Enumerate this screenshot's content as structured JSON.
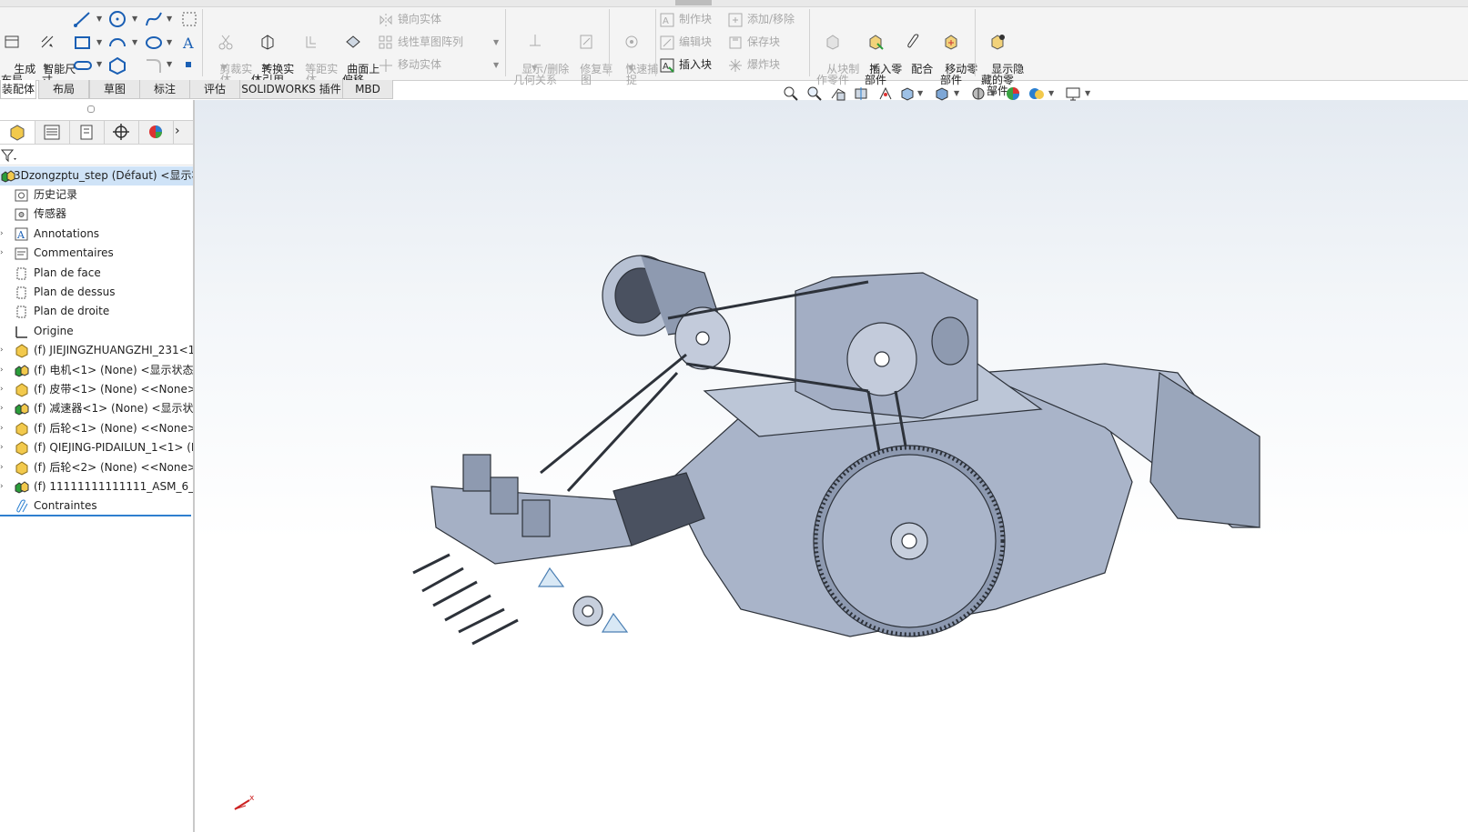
{
  "ribbon": {
    "row_group1": {
      "generate_layout": "生成\n布局",
      "smart_dimension": "智能尺\n寸"
    },
    "trim_entities": "剪裁实\n体",
    "convert_entities": "转换实\n体引用",
    "offset_entities": "等距实\n体",
    "offset_on_surface": "曲面上\n偏移",
    "mirror_entities": "镜向实体",
    "linear_pattern": "线性草图阵列",
    "move_entities": "移动实体",
    "display_delete_relations": "显示/删除\n几何关系",
    "repair_sketch": "修复草\n图",
    "quick_snaps": "快速捕\n捉",
    "make_block": "制作块",
    "edit_block": "编辑块",
    "insert_block": "插入块",
    "add_remove": "添加/移除",
    "save_block": "保存块",
    "explode_block": "爆炸块",
    "make_part_from_block": "从块制\n作零件",
    "insert_components": "插入零\n部件",
    "mate": "配合",
    "move_component": "移动零\n部件",
    "show_hidden_components": "显示隐\n藏的零\n部件"
  },
  "tabs": [
    {
      "label": "装配体",
      "active": true
    },
    {
      "label": "布局",
      "active": false
    },
    {
      "label": "草图",
      "active": false
    },
    {
      "label": "标注",
      "active": false
    },
    {
      "label": "评估",
      "active": false
    },
    {
      "label": "SOLIDWORKS 插件",
      "active": false
    },
    {
      "label": "MBD",
      "active": false
    }
  ],
  "tree": {
    "root": "3Dzongzptu_step (Défaut) <显示状",
    "items": [
      {
        "label": "历史记录",
        "icon": "history-icon"
      },
      {
        "label": "传感器",
        "icon": "sensor-icon"
      },
      {
        "label": "Annotations",
        "icon": "annotations-icon"
      },
      {
        "label": "Commentaires",
        "icon": "comments-icon"
      },
      {
        "label": "Plan de face",
        "icon": "plane-icon"
      },
      {
        "label": "Plan de dessus",
        "icon": "plane-icon"
      },
      {
        "label": "Plan de droite",
        "icon": "plane-icon"
      },
      {
        "label": "Origine",
        "icon": "origin-icon"
      },
      {
        "label": "(f) JIEJINGZHUANGZHI_231<1:",
        "icon": "part-icon"
      },
      {
        "label": "(f) 电机<1> (None) <显示状态-",
        "icon": "assembly-icon"
      },
      {
        "label": "(f) 皮带<1> (None) <<None>_",
        "icon": "part-icon"
      },
      {
        "label": "(f) 减速器<1> (None) <显示状态",
        "icon": "assembly-icon"
      },
      {
        "label": "(f) 后轮<1> (None) <<None>_",
        "icon": "part-icon"
      },
      {
        "label": "(f) QIEJING-PIDAILUN_1<1> (N",
        "icon": "part-icon"
      },
      {
        "label": "(f) 后轮<2> (None) <<None>_",
        "icon": "part-icon"
      },
      {
        "label": "(f) 11111111111111_ASM_6_AS",
        "icon": "assembly-icon"
      },
      {
        "label": "Contraintes",
        "icon": "mates-icon"
      }
    ]
  },
  "colors": {
    "model_body": "#a9b4c9",
    "model_dark": "#3a3f47",
    "selection_blue": "#2f7fcf",
    "tree_highlight": "#cfe3f7"
  }
}
